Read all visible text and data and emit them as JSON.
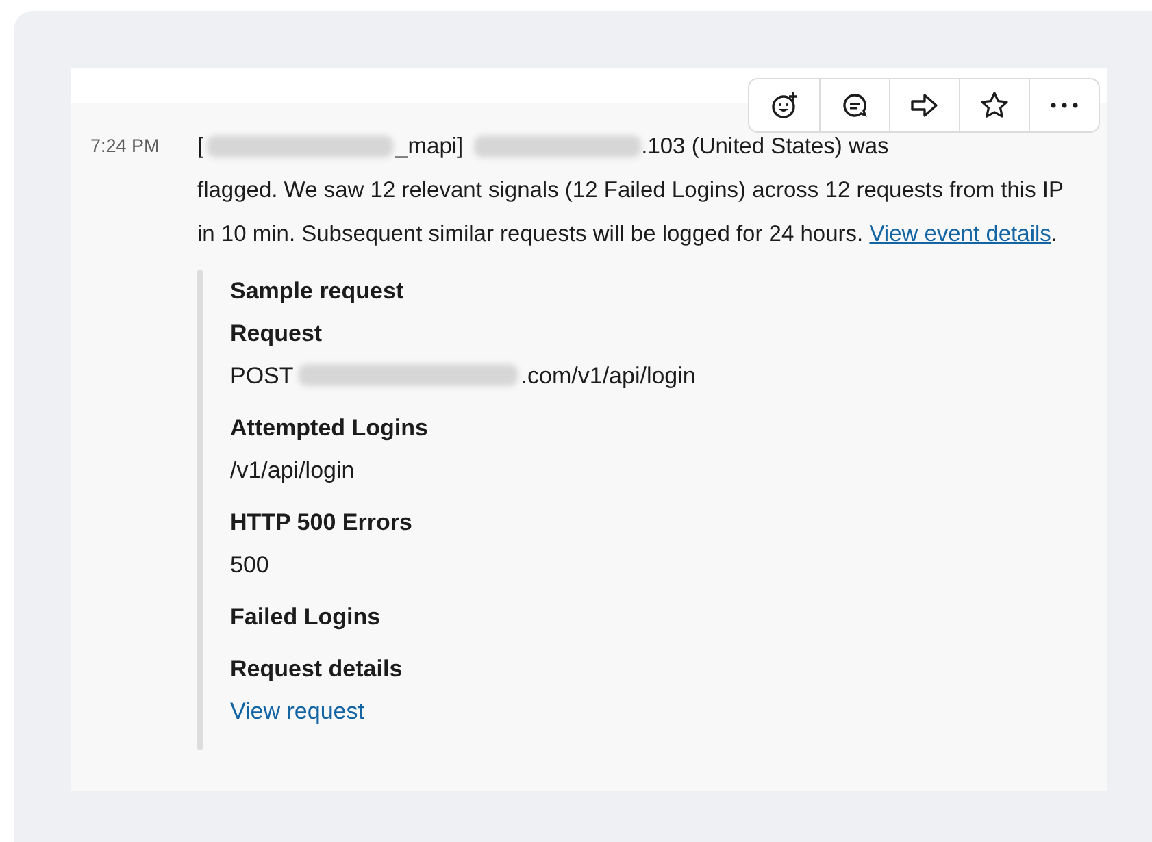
{
  "message": {
    "time": "7:24 PM",
    "first_line": [
      {
        "kind": "text",
        "text": "["
      },
      {
        "kind": "redacted"
      },
      {
        "kind": "text",
        "text": "_mapi]"
      },
      {
        "kind": "redacted"
      },
      {
        "kind": "text",
        "text": ".103 (United States) was"
      }
    ],
    "text": "flagged. We saw 12 relevant signals (12 Failed Logins) across 12 requests from this IP in 10 min. Subsequent similar requests will be logged for 24 hours.",
    "link": "View event details",
    "end": "."
  },
  "toolbar": [
    {
      "kind": "reaction"
    },
    {
      "kind": "thread"
    },
    {
      "kind": "share"
    },
    {
      "kind": "star"
    },
    {
      "kind": "more"
    }
  ],
  "attachment": {
    "title": "Sample request",
    "fields": [
      {
        "title": "Request",
        "value": [
          {
            "kind": "text",
            "text": "POST"
          },
          {
            "kind": "redacted"
          },
          {
            "kind": "text",
            "text": ".com/v1/api/login"
          }
        ]
      },
      {
        "title": "Attempted Logins",
        "value": [
          {
            "kind": "text",
            "text": "/v1/api/login"
          }
        ]
      },
      {
        "title": "HTTP 500 Errors",
        "value": [
          {
            "kind": "text",
            "text": "500"
          }
        ]
      },
      {
        "title": "Failed Logins"
      },
      {
        "title": "Request details",
        "value": [
          {
            "kind": "link",
            "text": "View request"
          }
        ]
      }
    ]
  }
}
